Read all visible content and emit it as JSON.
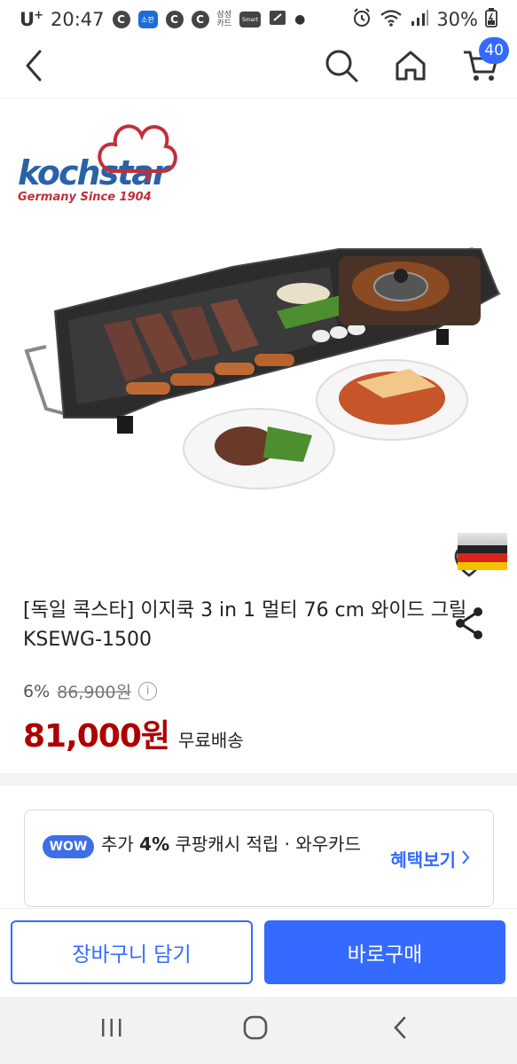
{
  "status_bar": {
    "carrier": "U",
    "carrier_sup": "+",
    "time": "20:47",
    "icons": [
      "c-icon",
      "app-icon",
      "c-icon",
      "c-icon",
      "samsung-card-icon",
      "smart-icon",
      "screen-icon",
      "dot-icon"
    ],
    "samsung_card_line1": "삼성",
    "samsung_card_line2": "카드",
    "app_label": "소판",
    "smart_label": "Smart",
    "battery": "30%"
  },
  "header": {
    "cart_count": "40"
  },
  "product": {
    "brand_name": "kochstar",
    "brand_tagline": "Germany Since 1904",
    "title": "[독일 콕스타] 이지쿡 3 in 1 멀티 76 cm 와이드 그릴 KSEWG-1500",
    "discount_percent": "6%",
    "original_price": "86,900원",
    "sale_price": "81,000원",
    "shipping": "무료배송"
  },
  "wow_card": {
    "badge": "WOW",
    "text_prefix": "추가 ",
    "text_bold": "4%",
    "text_suffix": " 쿠팡캐시 적립 · 와우카드",
    "link_label": "혜택보기"
  },
  "actions": {
    "add_to_cart": "장바구니 담기",
    "buy_now": "바로구매"
  },
  "colors": {
    "accent": "#346aff",
    "price_red": "#ae0000"
  }
}
